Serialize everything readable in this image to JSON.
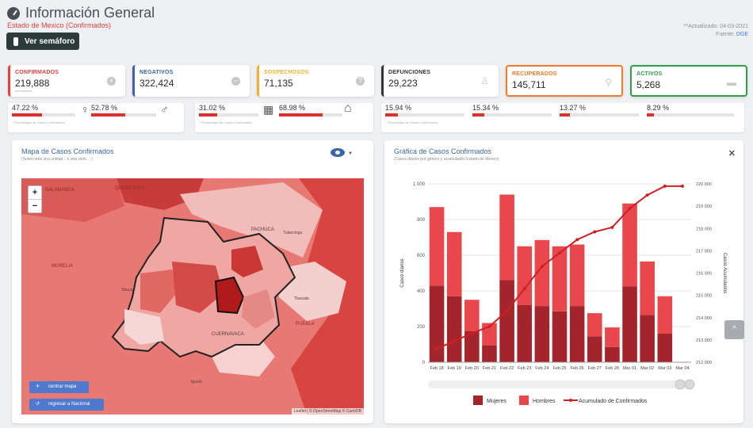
{
  "header": {
    "title": "Información General",
    "subtitle": "Estado de Mexico (Confirmados)",
    "updated": "**Actualizado: 04-03-2021",
    "source_label": "Fuente:",
    "source": "DGE",
    "semaforo_button": "Ver semáforo"
  },
  "cards": [
    {
      "label": "CONFIRMADOS",
      "value": "219,888",
      "color": "#e0443a",
      "icon": "plus-circle-icon"
    },
    {
      "label": "NEGATIVOS",
      "value": "322,424",
      "color": "#3b64ab",
      "icon": "minus-circle-icon"
    },
    {
      "label": "SOSPECHOSOS",
      "value": "71,135",
      "color": "#f3b12c",
      "icon": "question-circle-icon"
    },
    {
      "label": "DEFUNCIONES",
      "value": "29,223",
      "color": "#333333",
      "icon": "person-icon"
    },
    {
      "label": "RECUPERADOS",
      "value": "145,711",
      "color": "#f07a28",
      "icon": "walking-icon"
    },
    {
      "label": "ACTIVOS",
      "value": "5,268",
      "color": "#2f9e47",
      "icon": "bed-icon"
    }
  ],
  "stats": {
    "gender": {
      "female_pct": "47.22 %",
      "female": 0.4722,
      "male_pct": "52.78 %",
      "male": 0.5278,
      "note": "* Porcentajes de Casos Confirmados"
    },
    "ind": {
      "left_pct": "31.02 %",
      "left": 0.3102,
      "right_pct": "68.98 %",
      "right": 0.6898,
      "note": "* Porcentajes de Casos Confirmados"
    },
    "comorb": {
      "values": [
        "15.94 %",
        "15.34 %",
        "13.27 %",
        "8.29 %"
      ],
      "fracs": [
        0.1594,
        0.1534,
        0.1327,
        0.0829
      ],
      "note": "* Porcentajes de Casos Confirmados"
    }
  },
  "map_panel": {
    "title": "Mapa de Casos Confirmados",
    "subtitle": "(Seleccione una unidad ↓ o una vista →)",
    "zoom_in": "+",
    "zoom_out": "−",
    "btn_center": "centrar mapa",
    "btn_national": "regresar a Nacional",
    "attribution": "Leaflet | © OpenStreetMap © CartoDB",
    "place_labels": [
      "SALAMANCA",
      "QUERÉTARO",
      "MORELIA",
      "PACHUCA",
      "Tulancingo",
      "Tlaxcala",
      "PUEBLA",
      "CUERNAVACA",
      "Iguala",
      "Toluca"
    ]
  },
  "chart_panel": {
    "title": "Gráfica de Casos Confirmados",
    "subtitle": "(Casos diarios por género y acumulados Estado de Mexico)"
  },
  "chart_data": {
    "type": "bar",
    "categories": [
      "Feb 18",
      "Feb 19",
      "Feb 20",
      "Feb 21",
      "Feb 22",
      "Feb 23",
      "Feb 24",
      "Feb 25",
      "Feb 26",
      "Feb 27",
      "Feb 28",
      "Mar 01",
      "Mar 02",
      "Mar 03",
      "Mar 04"
    ],
    "series": [
      {
        "name": "Mujeres",
        "type": "bar",
        "values": [
          430,
          370,
          175,
          95,
          460,
          320,
          315,
          285,
          315,
          145,
          85,
          425,
          265,
          160,
          0
        ],
        "color": "#a3242a"
      },
      {
        "name": "Hombres",
        "type": "bar",
        "values": [
          440,
          360,
          175,
          125,
          480,
          330,
          370,
          365,
          345,
          130,
          110,
          465,
          300,
          210,
          0
        ],
        "color": "#e8474b"
      },
      {
        "name": "Acumulado de Confirmados",
        "type": "line",
        "axis": "right",
        "values": [
          212600,
          212950,
          213300,
          213600,
          214300,
          215300,
          216300,
          216900,
          217500,
          217850,
          218050,
          218900,
          219500,
          219900,
          219900
        ],
        "color": "#cf1f25"
      }
    ],
    "ylabel": "Casos diarios",
    "ylabel_right": "Casos Acumulados",
    "ylim": [
      0,
      1000
    ],
    "ylim_right": [
      212000,
      220000
    ],
    "yticks": [
      "0",
      "200",
      "400",
      "600",
      "800",
      "1 000"
    ],
    "yticks_right": [
      "212 000",
      "213 000",
      "214 000",
      "215 000",
      "216 000",
      "217 000",
      "218 000",
      "219 000",
      "220 000"
    ],
    "legend": "bottom",
    "grid": true
  },
  "scroll_top": "^"
}
